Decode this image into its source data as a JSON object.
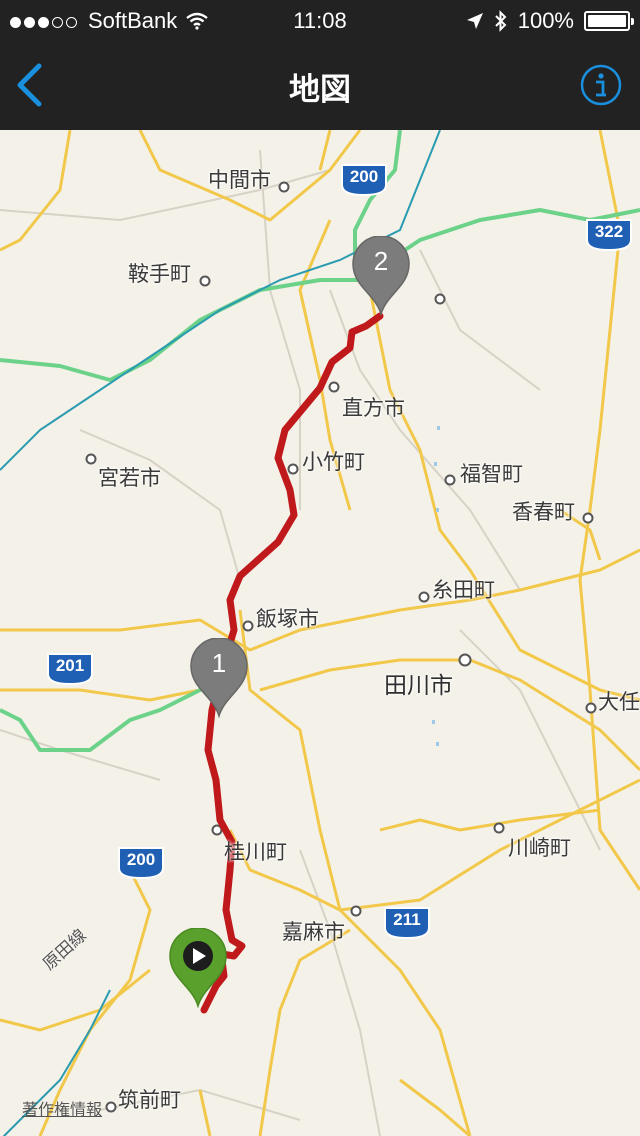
{
  "status_bar": {
    "carrier": "SoftBank",
    "time": "11:08",
    "battery": "100%",
    "signal_bars": 3
  },
  "nav": {
    "title": "地図",
    "back_icon": "chevron-left-icon",
    "info_icon": "info-icon"
  },
  "map": {
    "places": {
      "nakama": "中間市",
      "kurate": "鞍手町",
      "nogata": "直方市",
      "kotake": "小竹町",
      "miyawaka": "宮若市",
      "fukuchi": "福智町",
      "kawara": "香春町",
      "itoda": "糸田町",
      "iizuka": "飯塚市",
      "tagawa": "田川市",
      "oto": "大任",
      "keisen": "桂川町",
      "kawasaki": "川崎町",
      "kama": "嘉麻市",
      "chikuzen": "筑前町"
    },
    "routes": {
      "r200a": "200",
      "r322": "322",
      "r201": "201",
      "r200b": "200",
      "r211": "211"
    },
    "rail_line": "原田線",
    "copyright": "著作権情報",
    "markers": {
      "one": "1",
      "two": "2"
    },
    "colors": {
      "track": "#c0191c",
      "expressway": "#6cd28a",
      "start": "#5aa02c",
      "marker": "#7c7c7c",
      "accent": "#1a8fde"
    }
  }
}
